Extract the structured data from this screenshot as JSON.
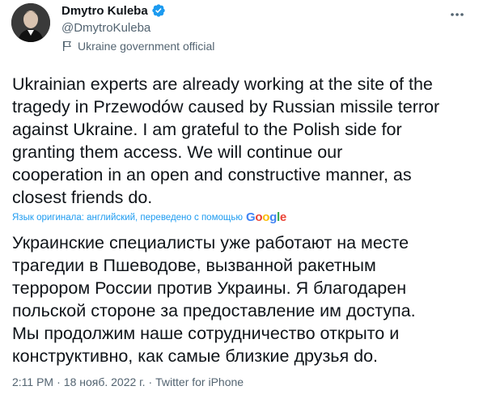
{
  "author": {
    "name": "Dmytro Kuleba",
    "handle": "@DmytroKuleba",
    "label": "Ukraine government official",
    "label_icon": "flag-icon",
    "verified_icon": "verified-badge-icon"
  },
  "tweet": {
    "text": "Ukrainian experts are already working at the site of the\ntragedy in Przewodów caused by Russian missile terror\nagainst Ukraine. I am grateful to the Polish side for\ngranting them access. We will continue our\ncooperation in an open and constructive manner, as\nclosest friends do.",
    "translation_note": "Язык оригинала: английский, переведено с помощью",
    "translation_provider": "Google",
    "translated_text": "Украинские специалисты уже работают на месте\nтрагедии в Пшеводове, вызванной ракетным\nтеррором России против Украины. Я благодарен\nпольской стороне за предоставление им доступа.\nМы продолжим наше сотрудничество открыто и\nконструктивно, как самые близкие друзья do."
  },
  "meta": {
    "time": "2:11 PM",
    "separator": "·",
    "date": "18 нояб. 2022 г.",
    "separator2": "·",
    "source": "Twitter for iPhone"
  },
  "colors": {
    "text": "#0f1419",
    "secondary": "#536471",
    "accent": "#1d9bf0"
  }
}
